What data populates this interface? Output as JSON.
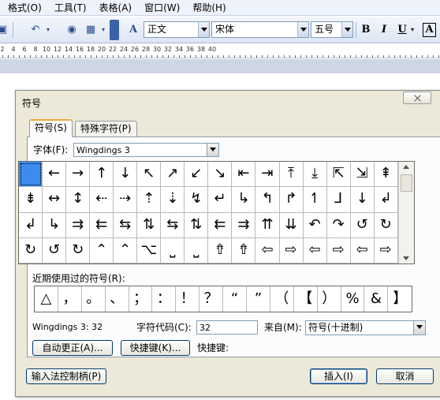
{
  "menubar": {
    "items": [
      "格式(O)",
      "工具(T)",
      "表格(A)",
      "窗口(W)",
      "帮助(H)"
    ]
  },
  "toolbar": {
    "style": "正文",
    "font": "宋体",
    "size": "五号",
    "bold": "B",
    "italic": "I",
    "underline": "U",
    "char_border": "A",
    "font_panel": "A"
  },
  "ruler": {
    "numbers": [
      "2",
      "4",
      "6",
      "8",
      "10",
      "12",
      "14",
      "16",
      "18",
      "20",
      "22",
      "24",
      "26",
      "28",
      "30",
      "32",
      "34",
      "36",
      "38",
      "40"
    ]
  },
  "dialog": {
    "title": "符号",
    "tabs": [
      "符号(S)",
      "特殊字符(P)"
    ],
    "font_label": "字体(F):",
    "font_value": "Wingdings 3",
    "symbols": [
      " ",
      "←",
      "→",
      "↑",
      "↓",
      "↖",
      "↗",
      "↙",
      "↘",
      "⇤",
      "⇥",
      "⤒",
      "⤓",
      "⇱",
      "⇲",
      "⇞",
      "⇟",
      "↔",
      "↕",
      "⇠",
      "⇢",
      "⇡",
      "⇣",
      "↯",
      "↵",
      "↳",
      "↰",
      "↱",
      "↿",
      "⅃",
      "↓",
      "↲",
      "↲",
      "↳",
      "⇉",
      "⇇",
      "⇆",
      "⇅",
      "⇆",
      "⇅",
      "⇇",
      "⇉",
      "⇈",
      "⇊",
      "↶",
      "↷",
      "↺",
      "↻",
      "↻",
      "↺",
      "↻",
      "⌃",
      "⌃",
      "⌥",
      "⎵",
      "⎵",
      "⇮",
      "⇮",
      "⇦",
      "⇨",
      "⇦",
      "⇨",
      "⇦",
      "⇨"
    ],
    "recent_label": "近期使用过的符号(R):",
    "recent": [
      "△",
      "，",
      "。",
      "、",
      "；",
      "：",
      "！",
      "？",
      "“",
      "”",
      "（",
      "【",
      "）",
      "%",
      "&",
      "】"
    ],
    "char_name": "Wingdings 3: 32",
    "charcode_label": "字符代码(C):",
    "charcode_value": "32",
    "from_label": "来自(M):",
    "from_value": "符号(十进制)",
    "autocorrect_button": "自动更正(A)...",
    "shortcut_button": "快捷键(K)...",
    "shortcut_label": "快捷键:",
    "ime_button": "输入法控制柄(P)",
    "insert_button": "插入(I)",
    "cancel_button": "取消"
  }
}
